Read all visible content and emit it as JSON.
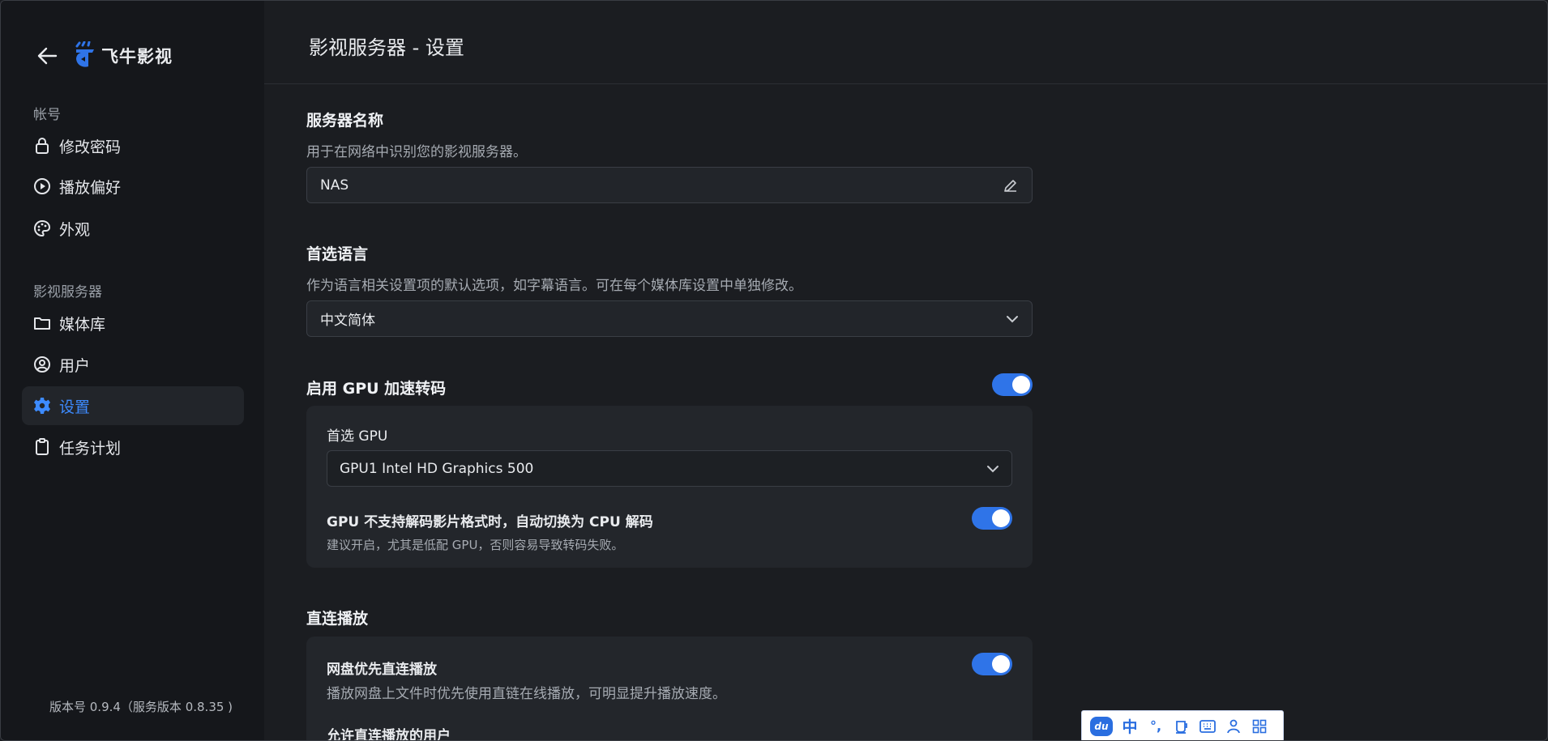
{
  "app": {
    "brand_name": "飞牛影视",
    "brand_color": "#2f74e8",
    "accent_color": "#3d8bff"
  },
  "sidebar": {
    "account_section": "帐号",
    "account_items": [
      {
        "label": "修改密码",
        "icon": "lock-icon"
      },
      {
        "label": "播放偏好",
        "icon": "play-circle-icon"
      },
      {
        "label": "外观",
        "icon": "palette-icon"
      }
    ],
    "server_section": "影视服务器",
    "server_items": [
      {
        "label": "媒体库",
        "icon": "folder-icon"
      },
      {
        "label": "用户",
        "icon": "user-circle-icon"
      },
      {
        "label": "设置",
        "icon": "gear-icon",
        "active": true
      },
      {
        "label": "任务计划",
        "icon": "clipboard-icon"
      }
    ],
    "version": "版本号 0.9.4（服务版本 0.8.35 )"
  },
  "header": {
    "title": "影视服务器 - 设置"
  },
  "settings": {
    "server_name": {
      "label": "服务器名称",
      "desc": "用于在网络中识别您的影视服务器。",
      "value": "NAS"
    },
    "language": {
      "label": "首选语言",
      "desc": "作为语言相关设置项的默认选项，如字幕语言。可在每个媒体库设置中单独修改。",
      "value": "中文简体"
    },
    "gpu": {
      "label": "启用 GPU 加速转码",
      "enabled": true,
      "preferred_label": "首选 GPU",
      "preferred_value": "GPU1 Intel HD Graphics 500",
      "fallback_label": "GPU 不支持解码影片格式时，自动切换为 CPU 解码",
      "fallback_desc": "建议开启，尤其是低配 GPU，否则容易导致转码失败。",
      "fallback_enabled": true
    },
    "direct_play": {
      "label": "直连播放",
      "cloud_label": "网盘优先直连播放",
      "cloud_desc": "播放网盘上文件时优先使用直链在线播放，可明显提升播放速度。",
      "cloud_enabled": true,
      "allowed_users_label": "允许直连播放的用户"
    }
  },
  "ime": {
    "logo": "du",
    "mode": "中",
    "punct": "°,"
  }
}
